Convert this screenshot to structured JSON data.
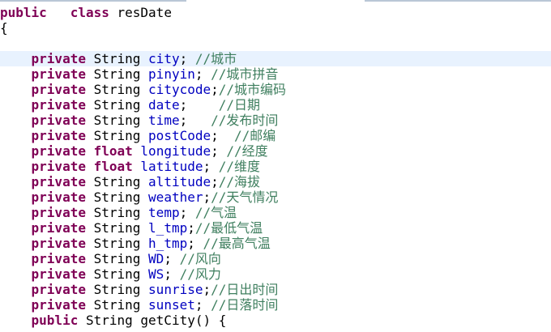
{
  "editor": {
    "class_decl": {
      "kw1": "public",
      "kw2": "class",
      "name": "resDate"
    },
    "open_brace": "{",
    "fields": [
      {
        "modifier": "private",
        "type": "String",
        "name": "city",
        "sep": "; ",
        "comment": "//城市"
      },
      {
        "modifier": "private",
        "type": "String",
        "name": "pinyin",
        "sep": "; ",
        "comment": "//城市拼音"
      },
      {
        "modifier": "private",
        "type": "String",
        "name": "citycode",
        "sep": ";",
        "comment": "//城市编码"
      },
      {
        "modifier": "private",
        "type": "String",
        "name": "date",
        "sep": ";    ",
        "comment": "//日期"
      },
      {
        "modifier": "private",
        "type": "String",
        "name": "time",
        "sep": ";   ",
        "comment": "//发布时间"
      },
      {
        "modifier": "private",
        "type": "String",
        "name": "postCode",
        "sep": ";  ",
        "comment": "//邮编"
      },
      {
        "modifier": "private",
        "type": "float",
        "name": "longitude",
        "sep": "; ",
        "comment": "//经度"
      },
      {
        "modifier": "private",
        "type": "float",
        "name": "latitude",
        "sep": "; ",
        "comment": "//维度"
      },
      {
        "modifier": "private",
        "type": "String",
        "name": "altitude",
        "sep": ";",
        "comment": "//海拔"
      },
      {
        "modifier": "private",
        "type": "String",
        "name": "weather",
        "sep": ";",
        "comment": "//天气情况"
      },
      {
        "modifier": "private",
        "type": "String",
        "name": "temp",
        "sep": "; ",
        "comment": "//气温"
      },
      {
        "modifier": "private",
        "type": "String",
        "name": "l_tmp",
        "sep": ";",
        "comment": "//最低气温"
      },
      {
        "modifier": "private",
        "type": "String",
        "name": "h_tmp",
        "sep": "; ",
        "comment": "//最高气温"
      },
      {
        "modifier": "private",
        "type": "String",
        "name": "WD",
        "sep": "; ",
        "comment": "//风向"
      },
      {
        "modifier": "private",
        "type": "String",
        "name": "WS",
        "sep": "; ",
        "comment": "//风力"
      },
      {
        "modifier": "private",
        "type": "String",
        "name": "sunrise",
        "sep": ";",
        "comment": "//日出时间"
      },
      {
        "modifier": "private",
        "type": "String",
        "name": "sunset",
        "sep": "; ",
        "comment": "//日落时间"
      }
    ],
    "method_decl": {
      "modifier": "public",
      "type": "String",
      "name": "getCity() {"
    }
  }
}
